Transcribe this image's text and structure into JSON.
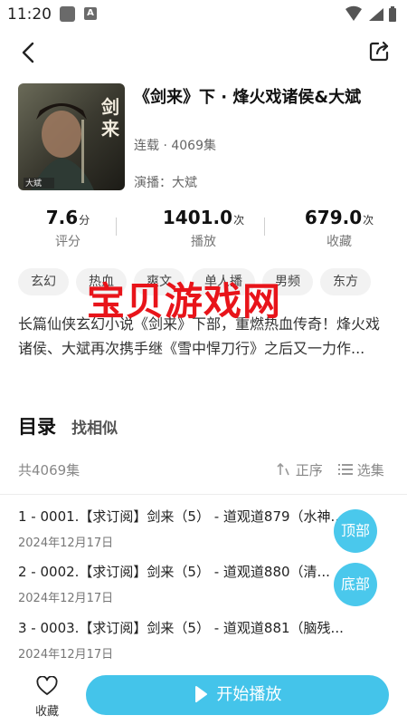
{
  "status_bar": {
    "time": "11:20",
    "badge": "A"
  },
  "header": {
    "back_icon": "chevron-left-icon",
    "share_icon": "share-icon"
  },
  "album": {
    "title": "《剑来》下 · 烽火戏诸侯&大斌",
    "status": "连载 · 4069集",
    "narrator": "演播：大斌",
    "cover_text": "剑来",
    "cover_sub": "大斌"
  },
  "stats": {
    "rating": {
      "value": "7.6",
      "unit": "分",
      "label": "评分"
    },
    "plays": {
      "value": "1401.0",
      "unit": "次",
      "label": "播放"
    },
    "favorites": {
      "value": "679.0",
      "unit": "次",
      "label": "收藏"
    }
  },
  "tags": [
    "玄幻",
    "热血",
    "爽文",
    "单人播",
    "男频",
    "东方"
  ],
  "watermark": "宝贝游戏网",
  "description": "长篇仙侠玄幻小说《剑来》下部，重燃热血传奇！烽火戏诸侯、大斌再次携手继《雪中悍刀行》之后又一力作...",
  "catalog": {
    "title": "目录",
    "similar": "找相似",
    "count": "共4069集",
    "sort_label": "正序",
    "select_label": "选集"
  },
  "episodes": [
    {
      "title": "1 - 0001.【求订阅】剑来（5） - 道观道879（水神...",
      "date": "2024年12月17日"
    },
    {
      "title": "2 - 0002.【求订阅】剑来（5） - 道观道880（清...",
      "date": "2024年12月17日"
    },
    {
      "title": "3 - 0003.【求订阅】剑来（5） - 道观道881（脑残...",
      "date": "2024年12月17日"
    }
  ],
  "float_buttons": {
    "top": "顶部",
    "bottom": "底部"
  },
  "bottom_bar": {
    "favorite_label": "收藏",
    "play_label": "开始播放"
  },
  "colors": {
    "accent": "#44c4ea",
    "watermark": "#e8141a"
  }
}
